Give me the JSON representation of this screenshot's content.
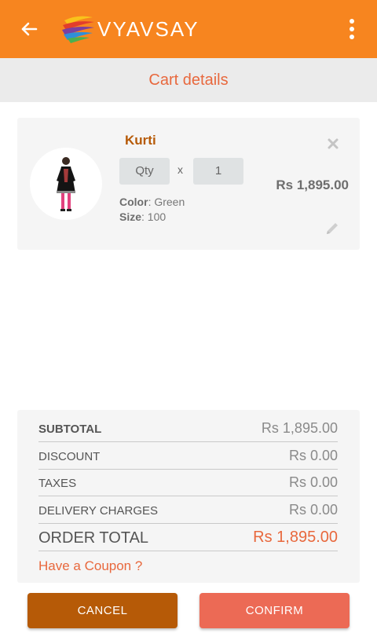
{
  "app": {
    "brand": "VYAVSAY",
    "accent_color": "#f7851f",
    "back_icon": "arrow-left-icon",
    "menu_icon": "more-vertical-icon"
  },
  "page": {
    "title": "Cart details"
  },
  "cart": {
    "items": [
      {
        "name": "Kurti",
        "qty_label": "Qty",
        "qty_separator": "x",
        "qty_value": "1",
        "price": "Rs 1,895.00",
        "color_label": "Color",
        "color_value": "Green",
        "size_label": "Size",
        "size_value": "100",
        "remove_icon": "close-icon",
        "edit_icon": "pencil-icon"
      }
    ]
  },
  "summary": {
    "subtotal_label": "SUBTOTAL",
    "subtotal_value": "Rs 1,895.00",
    "discount_label": "DISCOUNT",
    "discount_value": "Rs 0.00",
    "taxes_label": "TAXES",
    "taxes_value": "Rs 0.00",
    "delivery_label": "DELIVERY CHARGES",
    "delivery_value": "Rs 0.00",
    "total_label": "ORDER TOTAL",
    "total_value": "Rs 1,895.00",
    "coupon_link": "Have a Coupon ?"
  },
  "actions": {
    "cancel_label": "CANCEL",
    "confirm_label": "CONFIRM",
    "cancel_color": "#b65a07",
    "confirm_color": "#ec6a55"
  }
}
